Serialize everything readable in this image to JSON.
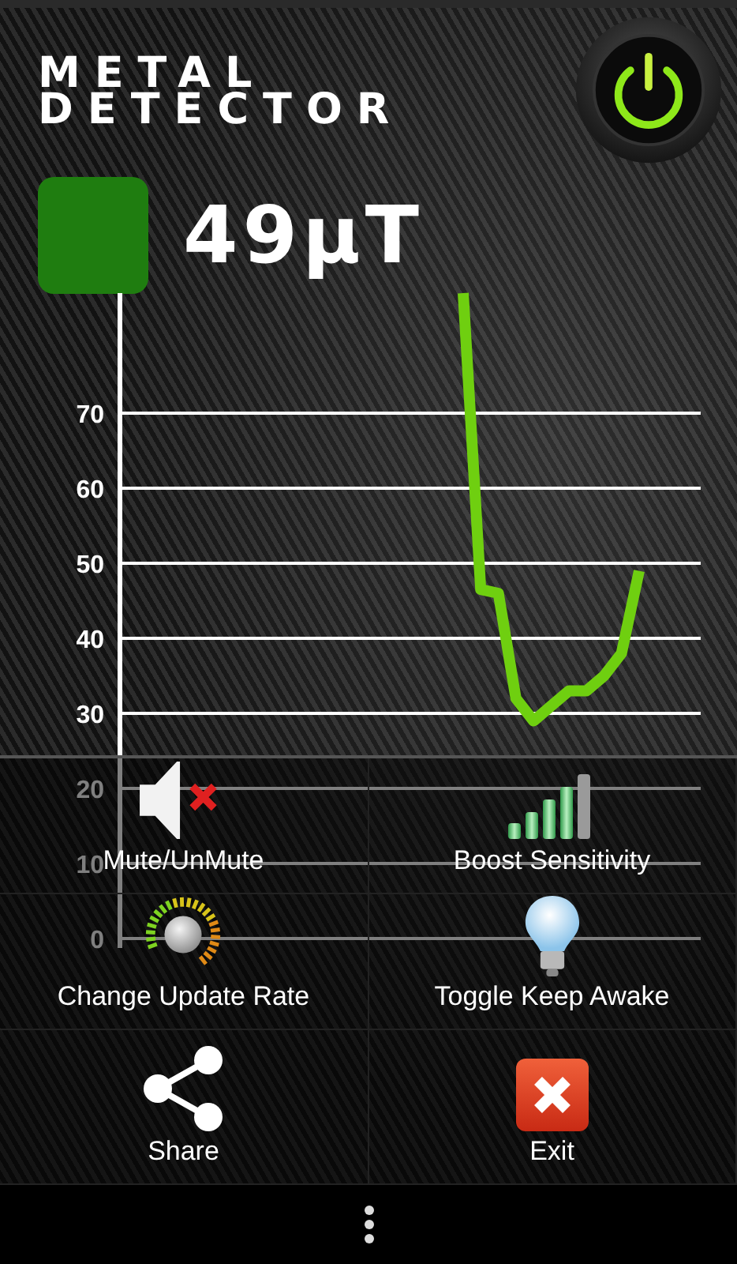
{
  "app": {
    "title_lines": [
      "METAL",
      "DETECTOR"
    ],
    "power": {
      "on": true
    }
  },
  "reading": {
    "value": "49µT"
  },
  "chart": {
    "chart_data": {
      "type": "line",
      "grid": true,
      "categories": [
        null,
        null,
        null,
        null,
        null,
        null,
        null,
        null,
        null,
        null,
        null,
        null,
        null,
        null,
        null,
        null,
        null,
        null,
        null,
        null,
        null,
        null,
        null,
        null,
        null,
        null,
        null,
        null,
        null,
        null,
        null,
        null,
        null
      ],
      "ylim": [
        0,
        86
      ],
      "yticks": [
        0,
        10,
        20,
        30,
        40,
        50,
        60,
        70
      ],
      "series": [
        {
          "color": "#6fcf10",
          "values": [
            null,
            null,
            null,
            null,
            null,
            null,
            null,
            null,
            null,
            null,
            null,
            null,
            null,
            null,
            null,
            null,
            null,
            null,
            null,
            86,
            46.5,
            46,
            32,
            29,
            31,
            33,
            33,
            35,
            38,
            49,
            null,
            null,
            null
          ]
        }
      ]
    }
  },
  "menu": [
    {
      "kind": "mute",
      "label": "Mute/UnMute"
    },
    {
      "kind": "signal",
      "label": "Boost Sensitivity"
    },
    {
      "kind": "dial",
      "label": "Change Update Rate"
    },
    {
      "kind": "bulb",
      "label": "Toggle Keep Awake"
    },
    {
      "kind": "share",
      "label": "Share"
    },
    {
      "kind": "exit",
      "label": "Exit"
    }
  ]
}
